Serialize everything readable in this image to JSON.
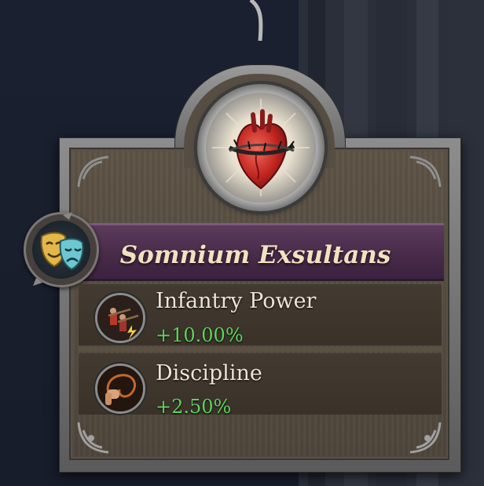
{
  "modifier": {
    "title": "Somnium Exsultans",
    "icon": "thorn-crowned-heart-icon",
    "badge_icon": "theater-masks-icon"
  },
  "effects": [
    {
      "label": "Infantry Power",
      "value": "+10.00%",
      "icon": "infantry-musketeers-icon"
    },
    {
      "label": "Discipline",
      "value": "+2.50%",
      "icon": "whip-icon"
    }
  ],
  "colors": {
    "banner": "#4a2c4a",
    "title": "#f1e2bf",
    "positive_value": "#5fd35e",
    "panel": "#574e43",
    "frame": "#7c7c7c"
  }
}
